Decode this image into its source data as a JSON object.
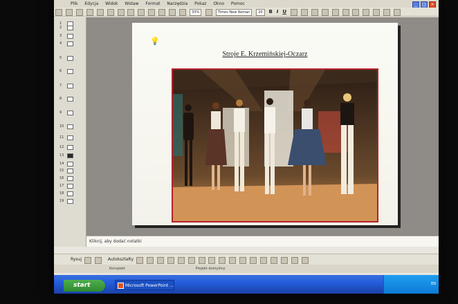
{
  "menubar": {
    "items": [
      "Plik",
      "Edycja",
      "Widok",
      "Wstaw",
      "Format",
      "Narzędzia",
      "Pokaz",
      "Okno",
      "Pomoc"
    ]
  },
  "toolbar": {
    "zoom": "33%",
    "font_name": "Times New Roman",
    "font_size": "20",
    "bold": "B",
    "italic": "I",
    "underline": "U"
  },
  "outline": {
    "slide_numbers": [
      "1",
      "2",
      "3",
      "4",
      "5",
      "6",
      "7",
      "8",
      "9",
      "10",
      "11",
      "12",
      "13",
      "14",
      "15",
      "16",
      "17",
      "18",
      "19"
    ],
    "active_index": 12
  },
  "slide": {
    "title": "Stroje E. Krzemińskiej-Oczarz"
  },
  "notes": {
    "placeholder": "Kliknij, aby dodać notatki"
  },
  "drawbar": {
    "draw_label": "Rysuj",
    "autoshapes_label": "Autokształty"
  },
  "statusbar": {
    "outline_tab": "Konspekt",
    "design": "Projekt domyślny"
  },
  "taskbar": {
    "start_label": "start",
    "task_label": "Microsoft PowerPoint ...",
    "tray_text": "EN"
  },
  "colors": {
    "photo_border": "#b3212a",
    "taskbar": "#245edb",
    "start_button": "#2f8a2f"
  }
}
